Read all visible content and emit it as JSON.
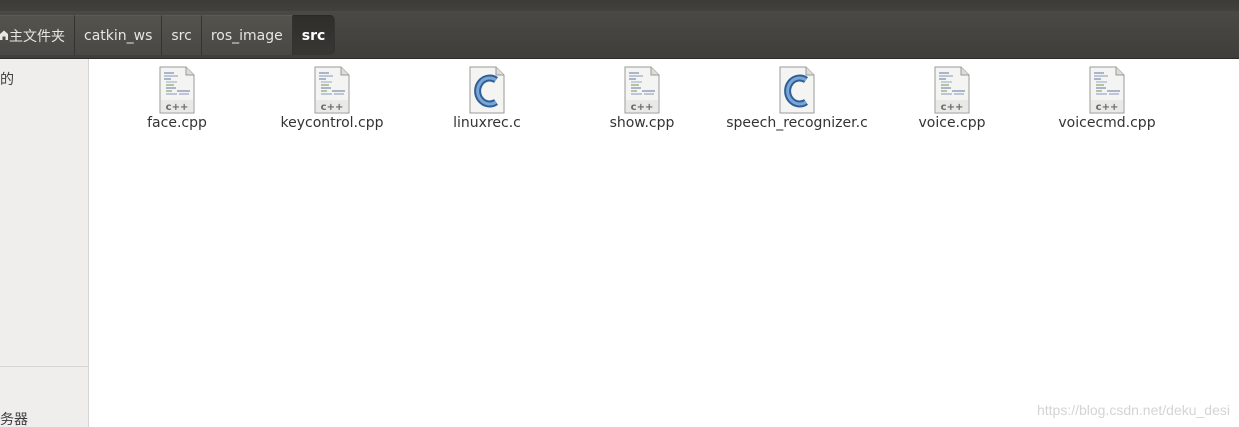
{
  "breadcrumbs": [
    {
      "label": "主文件夹",
      "active": false
    },
    {
      "label": "catkin_ws",
      "active": false
    },
    {
      "label": "src",
      "active": false
    },
    {
      "label": "ros_image",
      "active": false
    },
    {
      "label": "src",
      "active": true
    }
  ],
  "sidebar": {
    "top_item": "的",
    "bottom_item": "务器"
  },
  "files": [
    {
      "name": "face.cpp",
      "type": "cpp-source-icon",
      "badge": "c++"
    },
    {
      "name": "keycontrol.cpp",
      "type": "cpp-source-icon",
      "badge": "c++"
    },
    {
      "name": "linuxrec.c",
      "type": "c-source-icon",
      "badge": "C"
    },
    {
      "name": "show.cpp",
      "type": "cpp-source-icon",
      "badge": "c++"
    },
    {
      "name": "speech_recognizer.c",
      "type": "c-source-icon",
      "badge": "C"
    },
    {
      "name": "voice.cpp",
      "type": "cpp-source-icon",
      "badge": "c++"
    },
    {
      "name": "voicecmd.cpp",
      "type": "cpp-source-icon",
      "badge": "c++"
    }
  ],
  "watermark": "https://blog.csdn.net/deku_desi",
  "colors": {
    "toolbar": "#3f3e3a",
    "crumb_active": "#2f2e2b",
    "sidebar": "#efeeed",
    "c_icon_blue": "#3e6fa8"
  }
}
